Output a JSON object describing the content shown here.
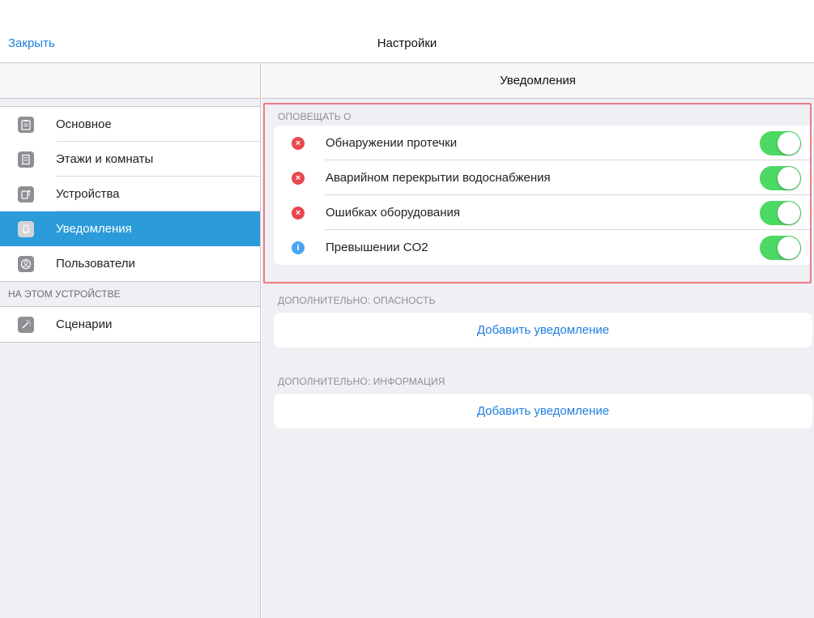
{
  "nav": {
    "close_label": "Закрыть",
    "title": "Настройки"
  },
  "sidebar": {
    "items": [
      {
        "label": "Основное",
        "icon": "clipboard-icon",
        "active": false
      },
      {
        "label": "Этажи и комнаты",
        "icon": "building-icon",
        "active": false
      },
      {
        "label": "Устройства",
        "icon": "device-icon",
        "active": false
      },
      {
        "label": "Уведомления",
        "icon": "bell-icon",
        "active": true
      },
      {
        "label": "Пользователи",
        "icon": "user-icon",
        "active": false
      }
    ],
    "section2_title": "НА ЭТОМ УСТРОЙСТВЕ",
    "section2_items": [
      {
        "label": "Сценарии",
        "icon": "magic-wand-icon",
        "active": false
      }
    ]
  },
  "detail": {
    "title": "Уведомления",
    "notify_section": {
      "title": "ОПОВЕЩАТЬ О",
      "rows": [
        {
          "label": "Обнаружении протечки",
          "status": "error",
          "enabled": true
        },
        {
          "label": "Аварийном перекрытии водоснабжения",
          "status": "error",
          "enabled": true
        },
        {
          "label": "Ошибках оборудования",
          "status": "error",
          "enabled": true
        },
        {
          "label": "Превышении CO2",
          "status": "info",
          "enabled": true
        }
      ]
    },
    "danger_section": {
      "title": "ДОПОЛНИТЕЛЬНО: ОПАСНОСТЬ",
      "button_label": "Добавить уведомление"
    },
    "info_section": {
      "title": "ДОПОЛНИТЕЛЬНО: ИНФОРМАЦИЯ",
      "button_label": "Добавить уведомление"
    }
  },
  "colors": {
    "accent": "#1f7fe0",
    "selected": "#2b9bd9",
    "toggle_on": "#4cd964",
    "error": "#e8484c",
    "info": "#4aa3f0",
    "highlight": "#ee7c82"
  }
}
